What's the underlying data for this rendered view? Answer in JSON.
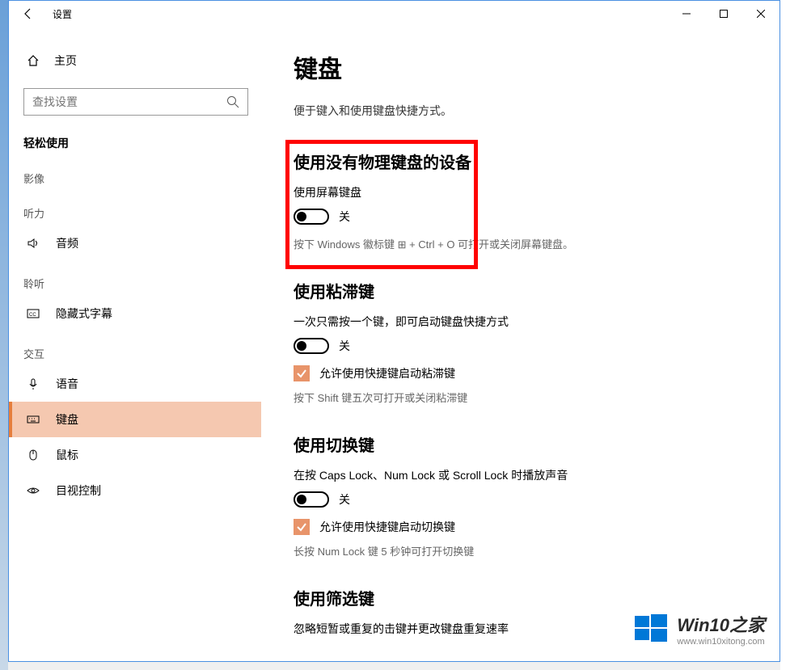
{
  "window": {
    "title": "设置"
  },
  "sidebar": {
    "home": "主页",
    "search_placeholder": "查找设置",
    "category": "轻松使用",
    "groups": [
      {
        "label": "影像"
      },
      {
        "label": "听力"
      }
    ],
    "items_audio": {
      "label": "音频"
    },
    "group_listen": "聆听",
    "item_captions": {
      "label": "隐藏式字幕"
    },
    "group_interact": "交互",
    "item_speech": {
      "label": "语音"
    },
    "item_keyboard": {
      "label": "键盘"
    },
    "item_mouse": {
      "label": "鼠标"
    },
    "item_eye": {
      "label": "目视控制"
    }
  },
  "content": {
    "title": "键盘",
    "desc": "便于键入和使用键盘快捷方式。",
    "section1": {
      "title": "使用没有物理键盘的设备",
      "label": "使用屏幕键盘",
      "state": "关",
      "hint": "按下 Windows 徽标键 ⊞ + Ctrl + O 可打开或关闭屏幕键盘。"
    },
    "section2": {
      "title": "使用粘滞键",
      "label": "一次只需按一个键，即可启动键盘快捷方式",
      "state": "关",
      "checkbox": "允许使用快捷键启动粘滞键",
      "hint": "按下 Shift 键五次可打开或关闭粘滞键"
    },
    "section3": {
      "title": "使用切换键",
      "label": "在按 Caps Lock、Num Lock 或 Scroll Lock 时播放声音",
      "state": "关",
      "checkbox": "允许使用快捷键启动切换键",
      "hint": "长按 Num Lock 键 5 秒钟可打开切换键"
    },
    "section4": {
      "title": "使用筛选键",
      "label": "忽略短暂或重复的击键并更改键盘重复速率"
    }
  },
  "watermark": {
    "title": "Win10之家",
    "url": "www.win10xitong.com"
  }
}
